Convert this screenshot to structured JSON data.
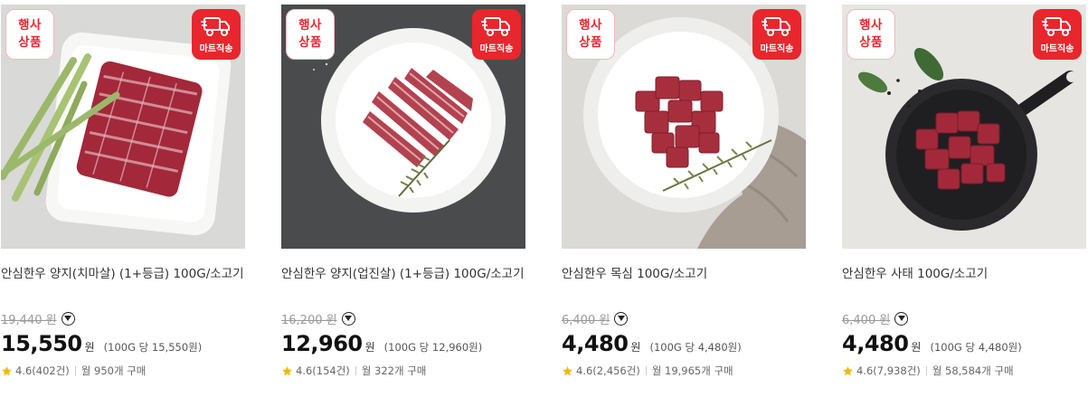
{
  "products": [
    {
      "badge_event": [
        "행사",
        "상품"
      ],
      "badge_mart": "마트직송",
      "title": "안심한우 양지(치마살) (1+등급) 100G/소고기",
      "original_price": "19,440 원",
      "price": "15,550",
      "currency": "원",
      "unit_price": "(100G 당 15,550원)",
      "rating": "4.6(402건)",
      "monthly": "월 950개 구매",
      "icon": "marbled-beef-plate-asparagus"
    },
    {
      "badge_event": [
        "행사",
        "상품"
      ],
      "badge_mart": "마트직송",
      "title": "안심한우 양지(업진살) (1+등급) 100G/소고기",
      "original_price": "16,200 원",
      "price": "12,960",
      "currency": "원",
      "unit_price": "(100G 당 12,960원)",
      "rating": "4.6(154건)",
      "monthly": "월 322개 구매",
      "icon": "beef-strips-plate-dark"
    },
    {
      "badge_event": [
        "행사",
        "상품"
      ],
      "badge_mart": "마트직송",
      "title": "안심한우 목심 100G/소고기",
      "original_price": "6,400 원",
      "price": "4,480",
      "currency": "원",
      "unit_price": "(100G 당 4,480원)",
      "rating": "4.6(2,456건)",
      "monthly": "월 19,965개 구매",
      "icon": "beef-cubes-plate-rosemary"
    },
    {
      "badge_event": [
        "행사",
        "상품"
      ],
      "badge_mart": "마트직송",
      "title": "안심한우 사태 100G/소고기",
      "original_price": "6,400 원",
      "price": "4,480",
      "currency": "원",
      "unit_price": "(100G 당 4,480원)",
      "rating": "4.6(7,938건)",
      "monthly": "월 58,584개 구매",
      "icon": "beef-cubes-pan-basil"
    }
  ],
  "colors": {
    "accent_red": "#e8262d",
    "star": "#f5b800"
  }
}
